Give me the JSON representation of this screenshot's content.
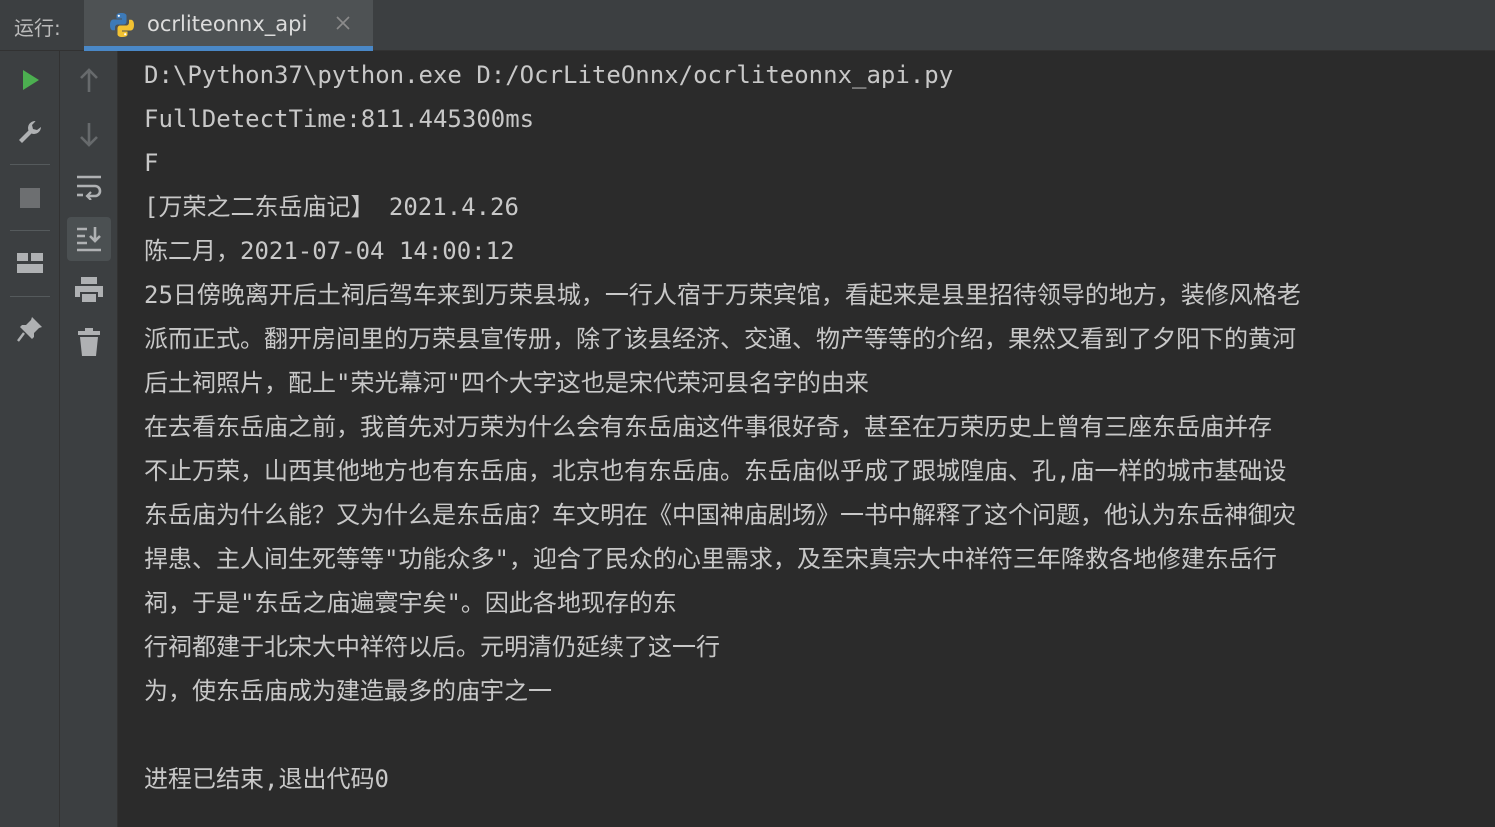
{
  "topbar": {
    "run_label": "运行:",
    "tab_title": "ocrliteonnx_api",
    "tab_icon": "python-icon",
    "close_icon": "close-icon"
  },
  "toolbar_left": [
    {
      "name": "run-icon",
      "color": "#4caf50"
    },
    {
      "name": "wrench-icon"
    },
    {
      "name": "stop-icon"
    },
    {
      "name": "layout-icon"
    },
    {
      "name": "pin-icon"
    }
  ],
  "toolbar_right": [
    {
      "name": "arrow-up-icon"
    },
    {
      "name": "arrow-down-icon"
    },
    {
      "name": "soft-wrap-icon"
    },
    {
      "name": "scroll-to-end-icon",
      "active": true
    },
    {
      "name": "print-icon"
    },
    {
      "name": "trash-icon"
    }
  ],
  "console": {
    "lines": [
      "D:\\Python37\\python.exe D:/OcrLiteOnnx/ocrliteonnx_api.py",
      "FullDetectTime:811.445300ms",
      "F",
      "[万荣之二东岳庙记】 2021.4.26",
      "陈二月，2021-07-04 14:00:12",
      "25日傍晚离开后土祠后驾车来到万荣县城，一行人宿于万荣宾馆，看起来是县里招待领导的地方，装修风格老",
      "派而正式。翻开房间里的万荣县宣传册，除了该县经济、交通、物产等等的介绍，果然又看到了夕阳下的黄河",
      "后土祠照片，配上\"荣光幕河\"四个大字这也是宋代荣河县名字的由来",
      "在去看东岳庙之前，我首先对万荣为什么会有东岳庙这件事很好奇，甚至在万荣历史上曾有三座东岳庙并存",
      "不止万荣，山西其他地方也有东岳庙，北京也有东岳庙。东岳庙似乎成了跟城隍庙、孔,庙一样的城市基础设",
      "东岳庙为什么能？又为什么是东岳庙？车文明在《中国神庙剧场》一书中解释了这个问题，他认为东岳神御灾",
      "捍患、主人间生死等等\"功能众多\"，迎合了民众的心里需求，及至宋真宗大中祥符三年降救各地修建东岳行",
      "祠，于是\"东岳之庙遍寰宇矣\"。因此各地现存的东",
      "行祠都建于北宋大中祥符以后。元明清仍延续了这一行",
      "为，使东岳庙成为建造最多的庙宇之一",
      "",
      "进程已结束,退出代码0"
    ]
  }
}
